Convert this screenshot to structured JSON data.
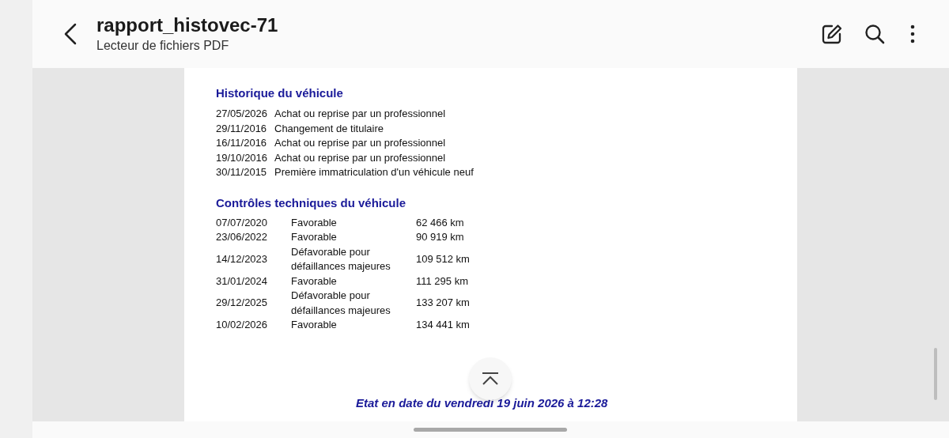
{
  "header": {
    "title": "rapport_histovec-71",
    "subtitle": "Lecteur de fichiers PDF"
  },
  "document": {
    "history": {
      "heading": "Historique du véhicule",
      "rows": [
        {
          "date": "27/05/2026",
          "event": "Achat ou reprise par un professionnel"
        },
        {
          "date": "29/11/2016",
          "event": "Changement de titulaire"
        },
        {
          "date": "16/11/2016",
          "event": "Achat ou reprise par un professionnel"
        },
        {
          "date": "19/10/2016",
          "event": "Achat ou reprise par un professionnel"
        },
        {
          "date": "30/11/2015",
          "event": "Première immatriculation d'un véhicule neuf"
        }
      ]
    },
    "inspections": {
      "heading": "Contrôles techniques du véhicule",
      "rows": [
        {
          "date": "07/07/2020",
          "result": [
            "Favorable"
          ],
          "mileage": "62 466 km"
        },
        {
          "date": "23/06/2022",
          "result": [
            "Favorable"
          ],
          "mileage": "90 919 km"
        },
        {
          "date": "14/12/2023",
          "result": [
            "Défavorable pour",
            "défaillances majeures"
          ],
          "mileage": "109 512 km"
        },
        {
          "date": "31/01/2024",
          "result": [
            "Favorable"
          ],
          "mileage": "111 295 km"
        },
        {
          "date": "29/12/2025",
          "result": [
            "Défavorable pour",
            "défaillances majeures"
          ],
          "mileage": "133 207 km"
        },
        {
          "date": "10/02/2026",
          "result": [
            "Favorable"
          ],
          "mileage": "134 441 km"
        }
      ]
    },
    "footer": "Etat en date du vendredi 19 juin 2026 à 12:28"
  }
}
